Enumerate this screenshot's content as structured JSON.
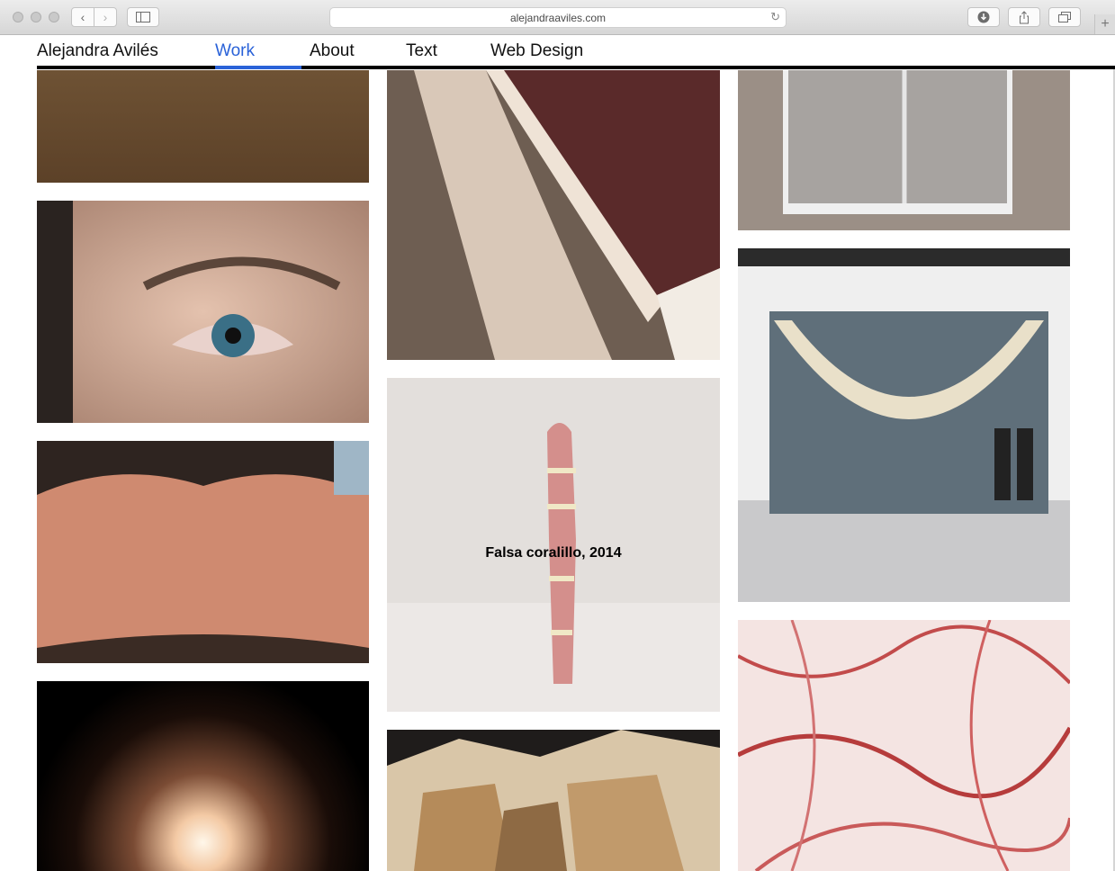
{
  "browser": {
    "url": "alejandraaviles.com",
    "icons": [
      "back-icon",
      "forward-icon",
      "sidebar-icon",
      "reload-icon",
      "download-icon",
      "share-icon",
      "tabs-icon",
      "new-tab-icon"
    ]
  },
  "nav": {
    "site_title": "Alejandra Avilés",
    "items": [
      {
        "label": "Work",
        "active": true
      },
      {
        "label": "About",
        "active": false
      },
      {
        "label": "Text",
        "active": false
      },
      {
        "label": "Web Design",
        "active": false
      }
    ],
    "accent": "#2a62d8"
  },
  "gallery": {
    "hover_caption": "Falsa coralillo, 2014"
  }
}
